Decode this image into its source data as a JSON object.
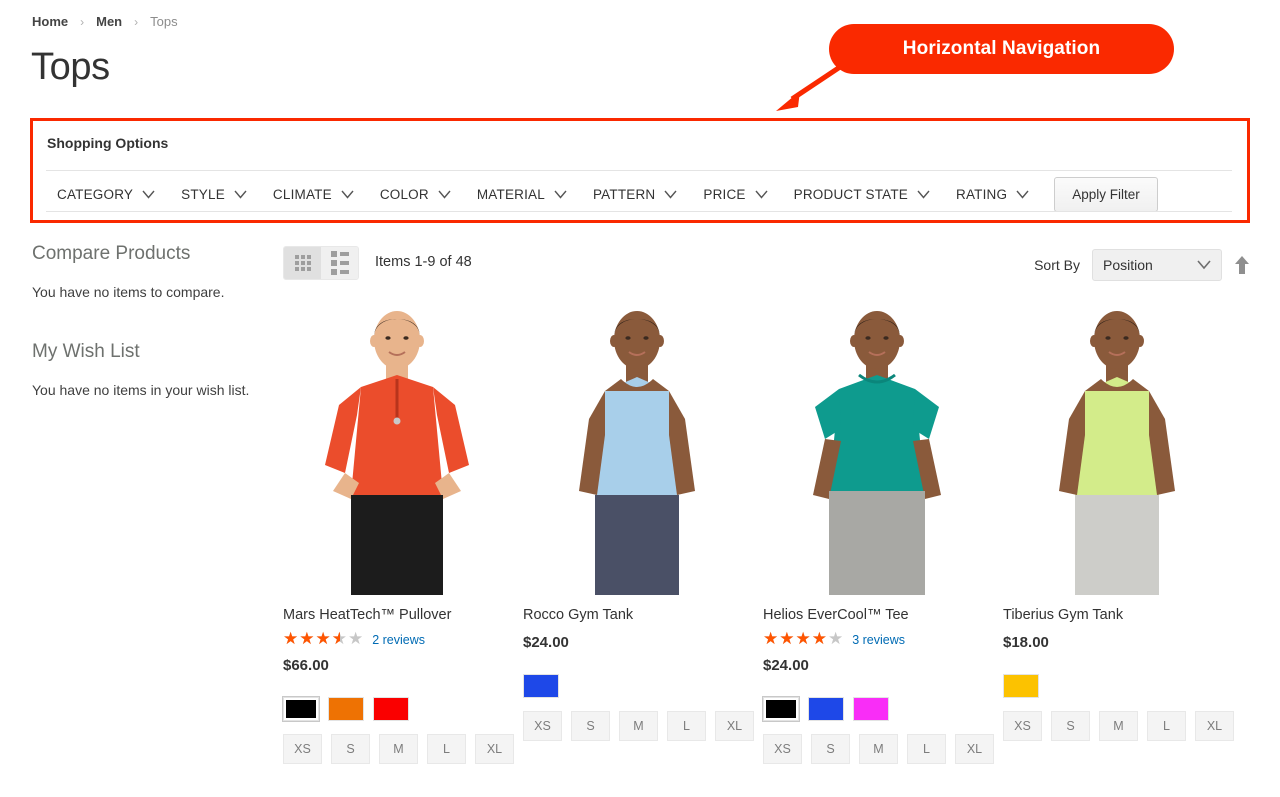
{
  "breadcrumb": {
    "items": [
      {
        "label": "Home",
        "style": "link"
      },
      {
        "label": "Men",
        "style": "link"
      },
      {
        "label": "Tops",
        "style": "current"
      }
    ],
    "separator": "›"
  },
  "page_title": "Tops",
  "callout": {
    "label": "Horizontal Navigation",
    "color": "#fa2900"
  },
  "filters": {
    "panel_title": "Shopping Options",
    "highlight_color": "#fa2900",
    "items": [
      {
        "label": "CATEGORY"
      },
      {
        "label": "STYLE"
      },
      {
        "label": "CLIMATE"
      },
      {
        "label": "COLOR"
      },
      {
        "label": "MATERIAL"
      },
      {
        "label": "PATTERN"
      },
      {
        "label": "PRICE"
      },
      {
        "label": "PRODUCT STATE"
      },
      {
        "label": "RATING"
      }
    ],
    "apply_label": "Apply Filter"
  },
  "sidebar": {
    "blocks": [
      {
        "title": "Compare Products",
        "text": "You have no items to compare."
      },
      {
        "title": "My Wish List",
        "text": "You have no items in your wish list."
      }
    ]
  },
  "toolbar": {
    "view_modes": [
      {
        "name": "grid",
        "active": true
      },
      {
        "name": "list",
        "active": false
      }
    ],
    "items_count": "Items 1-9 of 48",
    "sort_label": "Sort By",
    "sort_value": "Position",
    "sort_direction": "ascending"
  },
  "products": [
    {
      "name": "Mars HeatTech™ Pullover",
      "rating": 3.5,
      "reviews": "2 reviews",
      "has_rating": true,
      "price": "$66.00",
      "shirt_color": "#eb4d2c",
      "pants_color": "#1c1c1c",
      "skin_color": "#e8b48c",
      "hair_color": "#3a2a20",
      "sleeves": "long",
      "swatches": [
        {
          "color": "#000000",
          "selected": true
        },
        {
          "color": "#ee7203",
          "selected": false
        },
        {
          "color": "#fa0000",
          "selected": false
        }
      ],
      "sizes": [
        "XS",
        "S",
        "M",
        "L",
        "XL"
      ]
    },
    {
      "name": "Rocco Gym Tank",
      "rating": 0,
      "reviews": "",
      "has_rating": false,
      "price": "$24.00",
      "shirt_color": "#a8cfea",
      "pants_color": "#4a5066",
      "skin_color": "#8a5a3b",
      "hair_color": "#241a14",
      "sleeves": "sleeveless",
      "swatches": [
        {
          "color": "#1e48e8",
          "selected": false
        }
      ],
      "sizes": [
        "XS",
        "S",
        "M",
        "L",
        "XL"
      ]
    },
    {
      "name": "Helios EverCool™ Tee",
      "rating": 4,
      "reviews": "3 reviews",
      "has_rating": true,
      "price": "$24.00",
      "shirt_color": "#0e9b8e",
      "pants_color": "#a8a8a4",
      "skin_color": "#8a5a3b",
      "hair_color": "#241a14",
      "sleeves": "short",
      "swatches": [
        {
          "color": "#000000",
          "selected": true
        },
        {
          "color": "#1e48e8",
          "selected": false
        },
        {
          "color": "#f92df7",
          "selected": false
        }
      ],
      "sizes": [
        "XS",
        "S",
        "M",
        "L",
        "XL"
      ]
    },
    {
      "name": "Tiberius Gym Tank",
      "rating": 0,
      "reviews": "",
      "has_rating": false,
      "price": "$18.00",
      "shirt_color": "#d3ec8a",
      "pants_color": "#cdcdc9",
      "skin_color": "#8a5a3b",
      "hair_color": "#241a14",
      "sleeves": "tank",
      "swatches": [
        {
          "color": "#fcc200",
          "selected": false
        }
      ],
      "sizes": [
        "XS",
        "S",
        "M",
        "L",
        "XL"
      ]
    }
  ]
}
